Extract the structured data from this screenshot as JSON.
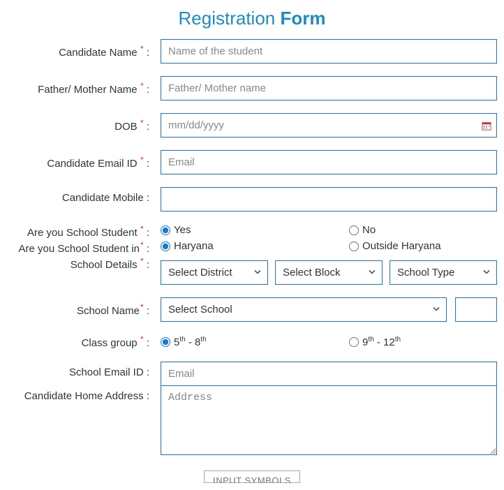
{
  "title_part1": "Registration ",
  "title_part2": "Form",
  "labels": {
    "candidate_name": "Candidate Name",
    "parent_name": "Father/ Mother Name",
    "dob": "DOB",
    "email": "Candidate Email ID",
    "mobile": "Candidate Mobile :",
    "are_student": "Are you School Student",
    "are_student_in": "Are you School Student in",
    "school_details": "School Details",
    "school_name": "School Name",
    "class_group": "Class group",
    "school_email": "School Email ID :",
    "home_address": "Candidate Home Address :"
  },
  "placeholders": {
    "candidate_name": "Name of the student",
    "parent_name": "Father/ Mother name",
    "dob": "mm/dd/yyyy",
    "email": "Email",
    "school_email": "Email",
    "address": "Address"
  },
  "radios": {
    "yes": "Yes",
    "no": "No",
    "haryana": "Haryana",
    "outside": "Outside Haryana",
    "class_a_pre": "5",
    "class_a_sup1": "th",
    "class_a_mid": " - 8",
    "class_a_sup2": "th",
    "class_b_pre": "9",
    "class_b_sup1": "th",
    "class_b_mid": " - 12",
    "class_b_sup2": "th"
  },
  "selects": {
    "district": "Select District",
    "block": "Select Block",
    "type": "School Type",
    "school": "Select School"
  },
  "footer_button": "INPUT SYMBOLS",
  "colon": " :"
}
